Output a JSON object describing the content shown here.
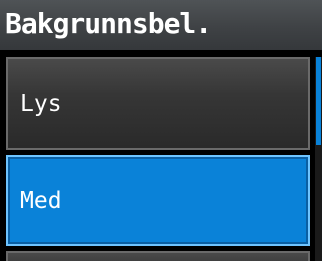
{
  "title": "Bakgrunnsbel.",
  "menu": {
    "items": [
      {
        "label": "Lys",
        "selected": false
      },
      {
        "label": "Med",
        "selected": true
      },
      {
        "label": "",
        "selected": false
      }
    ]
  },
  "colors": {
    "selected": "#0a82d8",
    "selected_border": "#6ec4ff",
    "item_bg": "#363636",
    "title_bg": "#3f4245",
    "text": "#ffffff"
  }
}
